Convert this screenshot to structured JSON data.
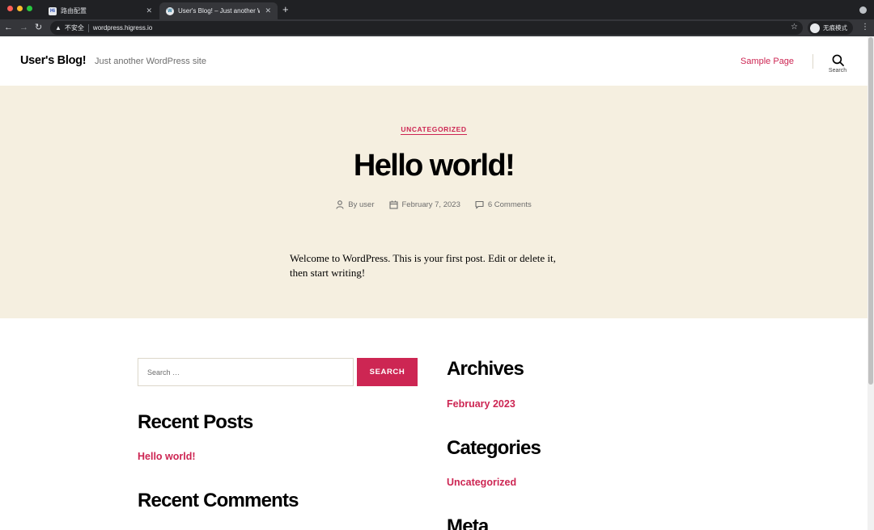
{
  "browser": {
    "tabs": [
      {
        "title": "路由配置",
        "favicon": "Hi",
        "active": false
      },
      {
        "title": "User's Blog! – Just another W",
        "favicon": "W",
        "active": true
      }
    ],
    "new_tab": "+",
    "url_warning": "不安全",
    "url": "wordpress.higress.io",
    "incognito_label": "无痕模式",
    "colors": {
      "close": "#ff5f57",
      "minimize": "#febc2e",
      "maximize": "#28c840"
    }
  },
  "site": {
    "title": "User's Blog!",
    "description": "Just another WordPress site",
    "nav": {
      "sample_page": "Sample Page"
    },
    "search_label": "Search"
  },
  "post": {
    "category": "UNCATEGORIZED",
    "title": "Hello world!",
    "author": "By user",
    "date": "February 7, 2023",
    "comments": "6 Comments",
    "body": "Welcome to WordPress. This is your first post. Edit or delete it, then start writing!"
  },
  "widgets": {
    "search": {
      "placeholder": "Search …",
      "button": "SEARCH"
    },
    "recent_posts": {
      "title": "Recent Posts",
      "items": [
        "Hello world!"
      ]
    },
    "recent_comments": {
      "title": "Recent Comments"
    },
    "archives": {
      "title": "Archives",
      "items": [
        "February 2023"
      ]
    },
    "categories": {
      "title": "Categories",
      "items": [
        "Uncategorized"
      ]
    },
    "meta": {
      "title": "Meta"
    }
  },
  "theme": {
    "accent": "#cd2653",
    "hero_bg": "#f5efe0"
  }
}
